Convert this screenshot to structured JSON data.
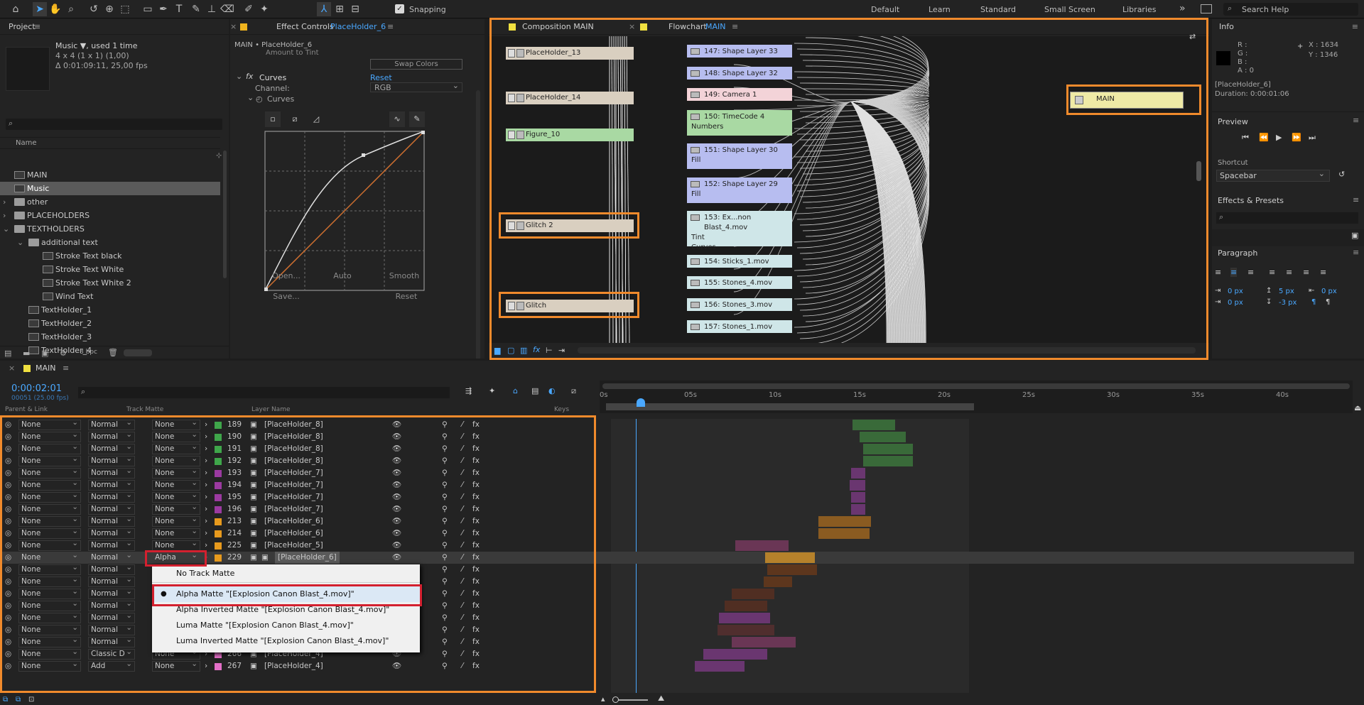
{
  "toolbar": {
    "snapping_label": "Snapping",
    "workspaces": [
      "Default",
      "Learn",
      "Standard",
      "Small Screen",
      "Libraries"
    ],
    "more_label": "»",
    "search_placeholder": "Search Help"
  },
  "project": {
    "title": "Project",
    "item_name": "Music ▼, used 1 time",
    "item_size": "4 x 4  (1 x 1) (1,00)",
    "item_duration": "Δ 0:01:09:11, 25,00 fps",
    "column_name": "Name",
    "bpc": "8 bpc",
    "items": [
      {
        "label": "MAIN",
        "indent": 0,
        "type": "comp"
      },
      {
        "label": "Music",
        "indent": 0,
        "type": "comp",
        "selected": true
      },
      {
        "label": "other",
        "indent": 0,
        "type": "folder"
      },
      {
        "label": "PLACEHOLDERS",
        "indent": 0,
        "type": "folder"
      },
      {
        "label": "TEXTHOLDERS",
        "indent": 0,
        "type": "folder"
      },
      {
        "label": "additional text",
        "indent": 1,
        "type": "folder"
      },
      {
        "label": "Stroke Text black",
        "indent": 2,
        "type": "comp"
      },
      {
        "label": "Stroke Text White",
        "indent": 2,
        "type": "comp"
      },
      {
        "label": "Stroke Text White 2",
        "indent": 2,
        "type": "comp"
      },
      {
        "label": "Wind Text",
        "indent": 2,
        "type": "comp"
      },
      {
        "label": "TextHolder_1",
        "indent": 1,
        "type": "comp"
      },
      {
        "label": "TextHolder_2",
        "indent": 1,
        "type": "comp"
      },
      {
        "label": "TextHolder_3",
        "indent": 1,
        "type": "comp"
      },
      {
        "label": "TextHolder_4",
        "indent": 1,
        "type": "comp"
      },
      {
        "label": "TextHolder_5",
        "indent": 1,
        "type": "comp"
      }
    ]
  },
  "effects": {
    "tab_label": "Effect Controls",
    "tab_layer": "PlaceHolder_6",
    "breadcrumb": "MAIN • PlaceHolder_6",
    "cut_row": "Amount to Tint",
    "swap_colors": "Swap Colors",
    "fx_label": "fx",
    "curves_label": "Curves",
    "reset_label": "Reset",
    "channel_label": "Channel:",
    "channel_value": "RGB",
    "curves_sub": "Curves",
    "open_btn": "Open...",
    "auto_btn": "Auto",
    "smooth_btn": "Smooth",
    "save_btn": "Save...",
    "reset_btn": "Reset"
  },
  "flowchart": {
    "comp_tab": "Composition MAIN",
    "flow_tab_prefix": "Flowchart",
    "flow_tab_name": "MAIN",
    "left_nodes": [
      "PlaceHolder_13",
      "PlaceHolder_14",
      "Figure_10",
      "Glitch 2",
      "Glitch"
    ],
    "right_nodes": [
      {
        "label": "147: Shape Layer 33",
        "color": "#b7bdf0"
      },
      {
        "label": "148: Shape Layer 32",
        "color": "#b7bdf0"
      },
      {
        "label": "149: Camera 1",
        "color": "#f3d3d8"
      },
      {
        "label": "150: TimeCode 4",
        "sub": "Numbers",
        "color": "#a9d9a3"
      },
      {
        "label": "151: Shape Layer 30",
        "sub": "Fill",
        "color": "#b7bdf0"
      },
      {
        "label": "152: Shape Layer 29",
        "sub": "Fill",
        "color": "#b7bdf0"
      },
      {
        "label": "153: Ex...non Blast_4.mov",
        "sub": "Tint",
        "sub2": "Curves",
        "color": "#cfe6e8"
      },
      {
        "label": "154: Sticks_1.mov",
        "color": "#cfe6e8"
      },
      {
        "label": "155: Stones_4.mov",
        "color": "#cfe6e8"
      },
      {
        "label": "156: Stones_3.mov",
        "color": "#cfe6e8"
      },
      {
        "label": "157: Stones_1.mov",
        "color": "#cfe6e8"
      }
    ],
    "target_node": "MAIN"
  },
  "info": {
    "title": "Info",
    "r": "R :",
    "g": "G :",
    "b": "B :",
    "a": "A :  0",
    "x": "X : 1634",
    "y": "Y : 1346",
    "layer": "[PlaceHolder_6]",
    "duration": "Duration: 0:00:01:06"
  },
  "preview": {
    "title": "Preview"
  },
  "shortcut": {
    "label": "Shortcut",
    "value": "Spacebar"
  },
  "effects_presets": {
    "title": "Effects & Presets"
  },
  "paragraph": {
    "title": "Paragraph",
    "v1": "0 px",
    "v2": "5 px",
    "v3": "0 px",
    "v4": "0 px",
    "v5": "-3 px"
  },
  "timeline": {
    "comp_name": "MAIN",
    "timecode": "0:00:02:01",
    "frame_info": "00051 (25.00 fps)",
    "col_parent": "Parent & Link",
    "col_trackmatte": "Track Matte",
    "col_layername": "Layer Name",
    "col_keys": "Keys",
    "ruler": [
      "0s",
      "05s",
      "10s",
      "15s",
      "20s",
      "25s",
      "30s",
      "35s",
      "40s"
    ],
    "rows": [
      {
        "parent": "None",
        "mode": "Normal",
        "matte": "None",
        "num": "189",
        "name": "[PlaceHolder_8]",
        "color": "#3fa64a"
      },
      {
        "parent": "None",
        "mode": "Normal",
        "matte": "None",
        "num": "190",
        "name": "[PlaceHolder_8]",
        "color": "#3fa64a"
      },
      {
        "parent": "None",
        "mode": "Normal",
        "matte": "None",
        "num": "191",
        "name": "[PlaceHolder_8]",
        "color": "#3fa64a"
      },
      {
        "parent": "None",
        "mode": "Normal",
        "matte": "None",
        "num": "192",
        "name": "[PlaceHolder_8]",
        "color": "#3fa64a"
      },
      {
        "parent": "None",
        "mode": "Normal",
        "matte": "None",
        "num": "193",
        "name": "[PlaceHolder_7]",
        "color": "#9b3aa0"
      },
      {
        "parent": "None",
        "mode": "Normal",
        "matte": "None",
        "num": "194",
        "name": "[PlaceHolder_7]",
        "color": "#9b3aa0"
      },
      {
        "parent": "None",
        "mode": "Normal",
        "matte": "None",
        "num": "195",
        "name": "[PlaceHolder_7]",
        "color": "#9b3aa0"
      },
      {
        "parent": "None",
        "mode": "Normal",
        "matte": "None",
        "num": "196",
        "name": "[PlaceHolder_7]",
        "color": "#9b3aa0"
      },
      {
        "parent": "None",
        "mode": "Normal",
        "matte": "None",
        "num": "213",
        "name": "[PlaceHolder_6]",
        "color": "#e79a1d"
      },
      {
        "parent": "None",
        "mode": "Normal",
        "matte": "None",
        "num": "214",
        "name": "[PlaceHolder_6]",
        "color": "#e79a1d"
      },
      {
        "parent": "None",
        "mode": "Normal",
        "matte": "None",
        "num": "225",
        "name": "[PlaceHolder_5]",
        "color": "#e79a1d"
      },
      {
        "parent": "None",
        "mode": "Normal",
        "matte": "Alpha",
        "num": "229",
        "name": "[PlaceHolder_6]",
        "color": "#e79a1d",
        "selected": true
      },
      {
        "parent": "None",
        "mode": "Normal",
        "matte": "",
        "num": "",
        "name": "",
        "color": ""
      },
      {
        "parent": "None",
        "mode": "Normal",
        "matte": "",
        "num": "",
        "name": "",
        "color": ""
      },
      {
        "parent": "None",
        "mode": "Normal",
        "matte": "",
        "num": "",
        "name": "",
        "color": ""
      },
      {
        "parent": "None",
        "mode": "Normal",
        "matte": "",
        "num": "",
        "name": "",
        "color": ""
      },
      {
        "parent": "None",
        "mode": "Normal",
        "matte": "",
        "num": "",
        "name": "",
        "color": ""
      },
      {
        "parent": "None",
        "mode": "Normal",
        "matte": "",
        "num": "",
        "name": "",
        "color": ""
      },
      {
        "parent": "None",
        "mode": "Normal",
        "matte": "Alpha",
        "num": "254",
        "name": "[PlaceHolder_4]",
        "color": "#e36fc7"
      },
      {
        "parent": "None",
        "mode": "Classic D",
        "matte": "None",
        "num": "266",
        "name": "[PlaceHolder_4]",
        "color": "#e36fc7"
      },
      {
        "parent": "None",
        "mode": "Add",
        "matte": "None",
        "num": "267",
        "name": "[PlaceHolder_4]",
        "color": "#e36fc7"
      }
    ],
    "menu": [
      "No Track Matte",
      "Alpha Matte \"[Explosion Canon Blast_4.mov]\"",
      "Alpha Inverted Matte \"[Explosion Canon Blast_4.mov]\"",
      "Luma Matte \"[Explosion Canon Blast_4.mov]\"",
      "Luma Inverted Matte \"[Explosion Canon Blast_4.mov]\""
    ]
  }
}
